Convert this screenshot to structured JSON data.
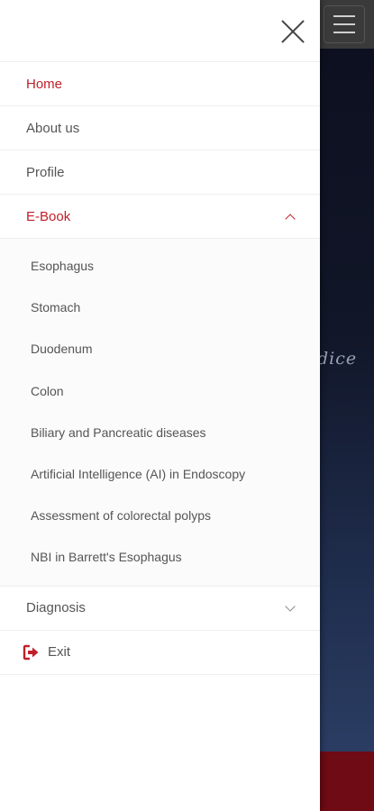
{
  "background": {
    "hero_text": "dice"
  },
  "drawer": {
    "close_label": "close",
    "items": [
      {
        "label": "Home",
        "active": true
      },
      {
        "label": "About us",
        "active": false
      },
      {
        "label": "Profile",
        "active": false
      },
      {
        "label": "E-Book",
        "active": true,
        "expanded": true
      }
    ],
    "ebook_items": [
      "Esophagus",
      "Stomach",
      "Duodenum",
      "Colon",
      "Biliary and Pancreatic diseases",
      "Artificial Intelligence (AI) in Endoscopy",
      "Assessment of colorectal polyps",
      "NBI in Barrett's Esophagus"
    ],
    "diagnosis_label": "Diagnosis",
    "exit_label": "Exit"
  },
  "colors": {
    "accent": "#c0202a",
    "text": "#555555",
    "footer": "#6e0b14"
  }
}
